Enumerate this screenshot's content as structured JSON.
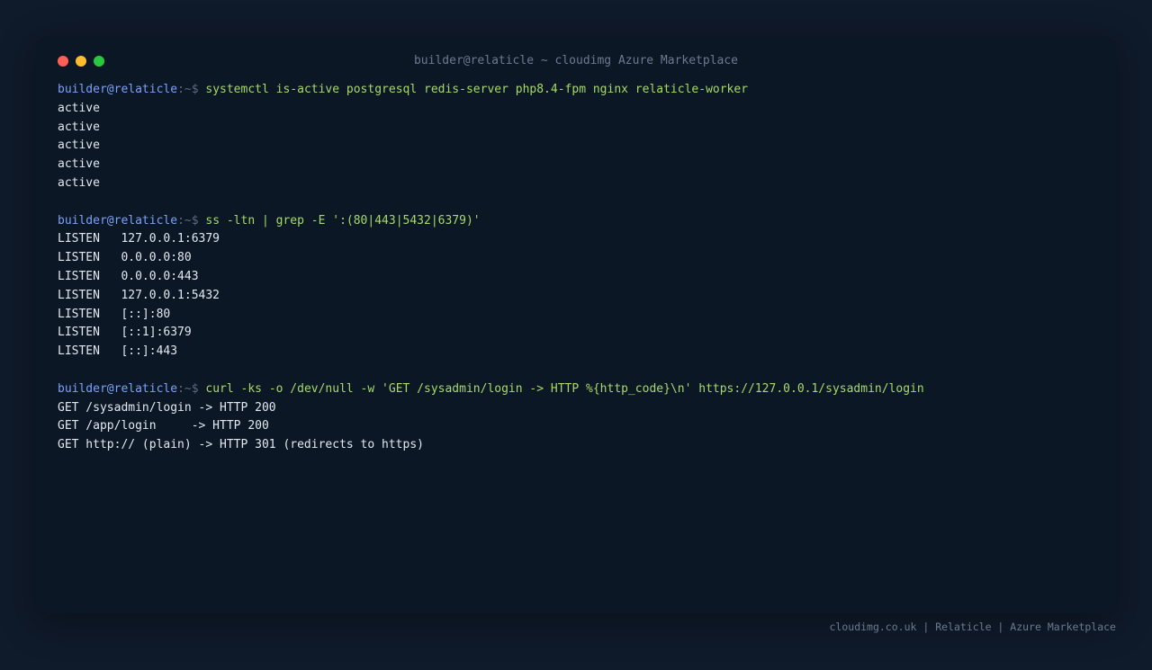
{
  "window": {
    "title": "builder@relaticle ~ cloudimg Azure Marketplace",
    "dot_colors": [
      "#ff5f57",
      "#febc2e",
      "#28c840"
    ]
  },
  "prompt": {
    "user_host": "builder@relaticle",
    "path_symbol": ":~$"
  },
  "blocks": [
    {
      "command": "systemctl is-active postgresql redis-server php8.4-fpm nginx relaticle-worker",
      "output": [
        "active",
        "active",
        "active",
        "active",
        "active"
      ]
    },
    {
      "command": "ss -ltn | grep -E ':(80|443|5432|6379)'",
      "output": [
        "LISTEN   127.0.0.1:6379",
        "LISTEN   0.0.0.0:80",
        "LISTEN   0.0.0.0:443",
        "LISTEN   127.0.0.1:5432",
        "LISTEN   [::]:80",
        "LISTEN   [::1]:6379",
        "LISTEN   [::]:443"
      ]
    },
    {
      "command": "curl -ks -o /dev/null -w 'GET /sysadmin/login -> HTTP %{http_code}\\n' https://127.0.0.1/sysadmin/login",
      "output": [
        "GET /sysadmin/login -> HTTP 200",
        "GET /app/login     -> HTTP 200",
        "GET http:// (plain) -> HTTP 301 (redirects to https)"
      ]
    }
  ],
  "footer": {
    "text": "cloudimg.co.uk | Relaticle | Azure Marketplace"
  },
  "colors": {
    "page_bg": "#0f1a2a",
    "terminal_bg": "#0c1726",
    "prompt_user": "#7aa2f7",
    "command": "#a6d96a",
    "output": "#e2e8f0"
  }
}
